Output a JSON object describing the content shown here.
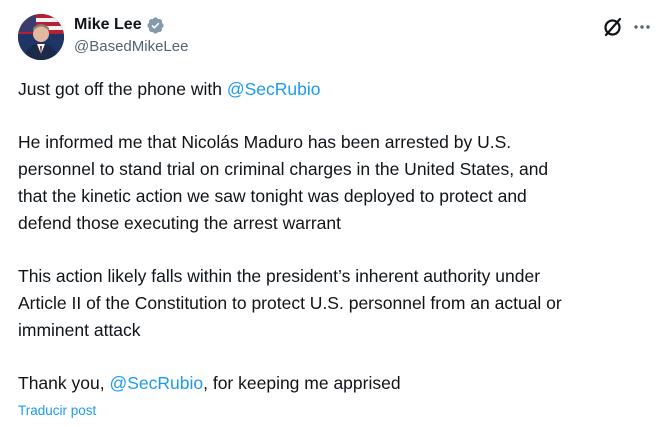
{
  "author": {
    "display_name": "Mike Lee",
    "handle": "@BasedMikeLee",
    "verified": true,
    "verified_color": "#829aab"
  },
  "icons": {
    "avatar": "avatar-photo",
    "verified": "verified-badge-icon",
    "grok": "grok-icon",
    "more": "more-options-icon"
  },
  "tweet": {
    "p1_text": "Just got off the phone with ",
    "p1_mention": "@SecRubio",
    "p2_lines": [
      "He informed me that Nicolás Maduro has been arrested by U.S.",
      "personnel to stand trial on criminal charges in the United States, and",
      "that the kinetic action we saw tonight was deployed to protect and",
      "defend those executing the arrest warrant"
    ],
    "p3_lines": [
      "This action likely falls within the president’s inherent authority under",
      "Article II of the Constitution to protect U.S. personnel from an actual or",
      "imminent attack"
    ],
    "p4_before": "Thank you, ",
    "p4_mention": "@SecRubio",
    "p4_after": ", for keeping me apprised"
  },
  "translate_label": "Traducir post",
  "colors": {
    "text": "#0f1419",
    "secondary": "#536471",
    "link": "#1d9bf0"
  }
}
